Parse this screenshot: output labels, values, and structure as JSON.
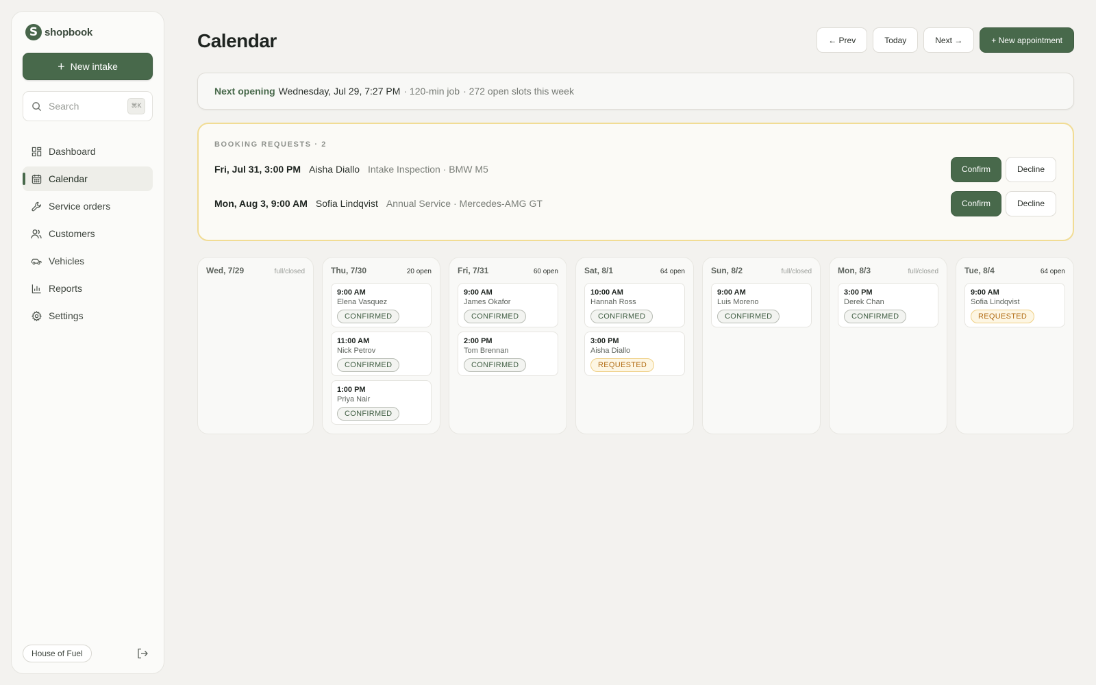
{
  "brand": {
    "name": "shopbook",
    "logo_letter": "S"
  },
  "sidebar": {
    "new_intake_label": "New intake",
    "search": {
      "placeholder": "Search",
      "shortcut": "⌘K"
    },
    "items": [
      {
        "label": "Dashboard",
        "icon": "dashboard-icon"
      },
      {
        "label": "Calendar",
        "icon": "calendar-icon",
        "active": true
      },
      {
        "label": "Service orders",
        "icon": "wrench-icon"
      },
      {
        "label": "Customers",
        "icon": "users-icon"
      },
      {
        "label": "Vehicles",
        "icon": "car-icon"
      },
      {
        "label": "Reports",
        "icon": "bar-chart-icon"
      },
      {
        "label": "Settings",
        "icon": "gear-icon"
      }
    ],
    "shop_name": "House of Fuel"
  },
  "header": {
    "title": "Calendar",
    "prev_label": "← Prev",
    "today_label": "Today",
    "next_label": "Next →",
    "new_appointment_label": "+ New appointment"
  },
  "next_opening": {
    "label": "Next opening",
    "date": "Wednesday, Jul 29, 7:27 PM",
    "job": "· 120-min job",
    "slots": "· 272 open slots this week"
  },
  "booking_requests": {
    "title": "BOOKING REQUESTS · 2",
    "confirm_label": "Confirm",
    "decline_label": "Decline",
    "items": [
      {
        "when": "Fri, Jul 31, 3:00 PM",
        "name": "Aisha Diallo",
        "detail": "Intake Inspection · BMW M5"
      },
      {
        "when": "Mon, Aug 3, 9:00 AM",
        "name": "Sofia Lindqvist",
        "detail": "Annual Service · Mercedes-AMG GT"
      }
    ]
  },
  "days": [
    {
      "name": "Wed, 7/29",
      "open": "full/closed",
      "appointments": []
    },
    {
      "name": "Thu, 7/30",
      "open": "20 open",
      "appointments": [
        {
          "time": "9:00 AM",
          "name": "Elena Vasquez",
          "status": "CONFIRMED"
        },
        {
          "time": "11:00 AM",
          "name": "Nick Petrov",
          "status": "CONFIRMED"
        },
        {
          "time": "1:00 PM",
          "name": "Priya Nair",
          "status": "CONFIRMED"
        }
      ]
    },
    {
      "name": "Fri, 7/31",
      "open": "60 open",
      "appointments": [
        {
          "time": "9:00 AM",
          "name": "James Okafor",
          "status": "CONFIRMED"
        },
        {
          "time": "2:00 PM",
          "name": "Tom Brennan",
          "status": "CONFIRMED"
        }
      ]
    },
    {
      "name": "Sat, 8/1",
      "open": "64 open",
      "appointments": [
        {
          "time": "10:00 AM",
          "name": "Hannah Ross",
          "status": "CONFIRMED"
        },
        {
          "time": "3:00 PM",
          "name": "Aisha Diallo",
          "status": "REQUESTED"
        }
      ]
    },
    {
      "name": "Sun, 8/2",
      "open": "full/closed",
      "appointments": [
        {
          "time": "9:00 AM",
          "name": "Luis Moreno",
          "status": "CONFIRMED"
        }
      ]
    },
    {
      "name": "Mon, 8/3",
      "open": "full/closed",
      "appointments": [
        {
          "time": "3:00 PM",
          "name": "Derek Chan",
          "status": "CONFIRMED"
        }
      ]
    },
    {
      "name": "Tue, 8/4",
      "open": "64 open",
      "appointments": [
        {
          "time": "9:00 AM",
          "name": "Sofia Lindqvist",
          "status": "REQUESTED"
        }
      ]
    }
  ],
  "colors": {
    "accent": "#48694b",
    "requested": "#b06a10",
    "requests_border": "#f1dc94"
  }
}
